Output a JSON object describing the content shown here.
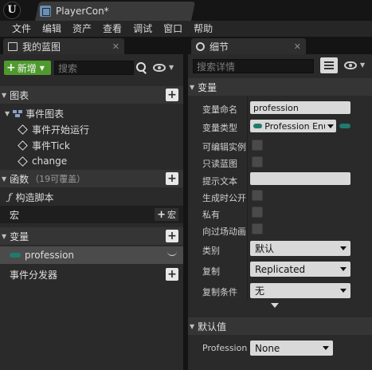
{
  "window": {
    "tab_title": "PlayerCon*"
  },
  "menu": [
    "文件",
    "编辑",
    "资产",
    "查看",
    "调试",
    "窗口",
    "帮助"
  ],
  "my_blueprint": {
    "tab_label": "我的蓝图",
    "add_button": "新增",
    "search_placeholder": "搜索",
    "sections": {
      "graphs": "图表",
      "functions": "函数",
      "functions_hint": "（19可覆盖）",
      "macros": "宏",
      "macros_add": "宏",
      "variables": "变量",
      "dispatchers": "事件分发器"
    },
    "event_graph": "事件图表",
    "events": [
      "事件开始运行",
      "事件Tick",
      "change"
    ],
    "construction_script": "构造脚本",
    "variable_item": "profession"
  },
  "details": {
    "tab_label": "细节",
    "search_placeholder": "搜索详情",
    "variable_section": "变量",
    "default_section": "默认值",
    "props": {
      "name_label": "变量命名",
      "name_value": "profession",
      "type_label": "变量类型",
      "type_value": "Profession Enu",
      "instance_editable": "可编辑实例",
      "blueprint_readonly": "只读蓝图",
      "tooltip": "提示文本",
      "expose_on_spawn": "生成时公开",
      "private": "私有",
      "expose_cinematics": "向过场动画",
      "category_label": "类别",
      "category_value": "默认",
      "replication_label": "复制",
      "replication_value": "Replicated",
      "repl_condition_label": "复制条件",
      "repl_condition_value": "无",
      "default_label": "Profession",
      "default_value": "None"
    }
  },
  "colors": {
    "accent_green": "#4f9a2e",
    "enum_pill": "#1f7a6e",
    "selected_row": "#4b4b4b"
  }
}
